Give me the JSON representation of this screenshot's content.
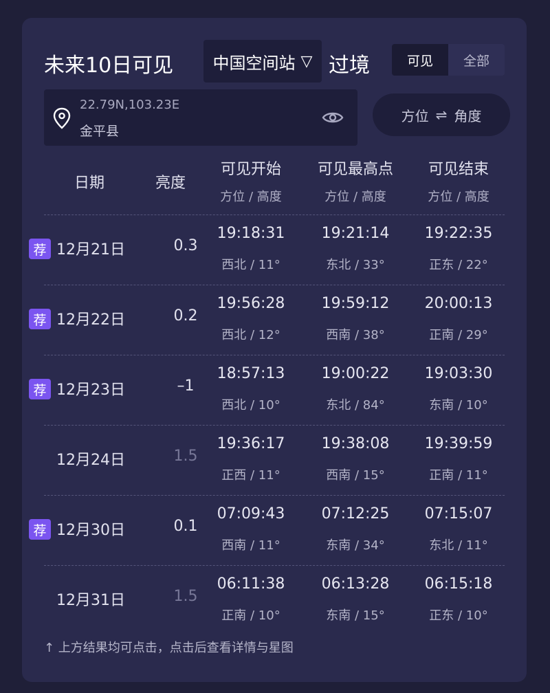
{
  "title": {
    "prefix": "未来10日可见",
    "satellite": "中国空间站",
    "dropdown_icon": "▽",
    "suffix": "过境"
  },
  "filter": {
    "visible_label": "可见",
    "all_label": "全部",
    "selected": "可见"
  },
  "location": {
    "coords": "22.79N,103.23E",
    "county": "金平县"
  },
  "toggle": {
    "left": "方位",
    "symbol": "⇌",
    "right": "角度"
  },
  "headers": {
    "date": "日期",
    "brightness": "亮度",
    "start": {
      "title": "可见开始",
      "sub": "方位 / 高度"
    },
    "peak": {
      "title": "可见最高点",
      "sub": "方位 / 高度"
    },
    "end": {
      "title": "可见结束",
      "sub": "方位 / 高度"
    }
  },
  "badge_label": "荐",
  "passes": [
    {
      "recommended": true,
      "date": "12月21日",
      "brightness": "0.3",
      "dim": false,
      "start": {
        "time": "19:18:31",
        "pos": "西北 / 11°"
      },
      "peak": {
        "time": "19:21:14",
        "pos": "东北 / 33°"
      },
      "end": {
        "time": "19:22:35",
        "pos": "正东 / 22°"
      }
    },
    {
      "recommended": true,
      "date": "12月22日",
      "brightness": "0.2",
      "dim": false,
      "start": {
        "time": "19:56:28",
        "pos": "西北 / 12°"
      },
      "peak": {
        "time": "19:59:12",
        "pos": "西南 / 38°"
      },
      "end": {
        "time": "20:00:13",
        "pos": "正南 / 29°"
      }
    },
    {
      "recommended": true,
      "date": "12月23日",
      "brightness": "–1",
      "dim": false,
      "start": {
        "time": "18:57:13",
        "pos": "西北 / 10°"
      },
      "peak": {
        "time": "19:00:22",
        "pos": "东北 / 84°"
      },
      "end": {
        "time": "19:03:30",
        "pos": "东南 / 10°"
      }
    },
    {
      "recommended": false,
      "date": "12月24日",
      "brightness": "1.5",
      "dim": true,
      "start": {
        "time": "19:36:17",
        "pos": "正西 / 11°"
      },
      "peak": {
        "time": "19:38:08",
        "pos": "西南 / 15°"
      },
      "end": {
        "time": "19:39:59",
        "pos": "正南 / 11°"
      }
    },
    {
      "recommended": true,
      "date": "12月30日",
      "brightness": "0.1",
      "dim": false,
      "start": {
        "time": "07:09:43",
        "pos": "西南 / 11°"
      },
      "peak": {
        "time": "07:12:25",
        "pos": "东南 / 34°"
      },
      "end": {
        "time": "07:15:07",
        "pos": "东北 / 11°"
      }
    },
    {
      "recommended": false,
      "date": "12月31日",
      "brightness": "1.5",
      "dim": true,
      "start": {
        "time": "06:11:38",
        "pos": "正南 / 10°"
      },
      "peak": {
        "time": "06:13:28",
        "pos": "东南 / 15°"
      },
      "end": {
        "time": "06:15:18",
        "pos": "正东 / 10°"
      }
    }
  ],
  "footer": "↑ 上方结果均可点击，点击后查看详情与星图",
  "colors": {
    "background": "#1f1f38",
    "card": "#2a2a4d",
    "badge": "#7b55f0",
    "panel": "#1e1e3a"
  }
}
